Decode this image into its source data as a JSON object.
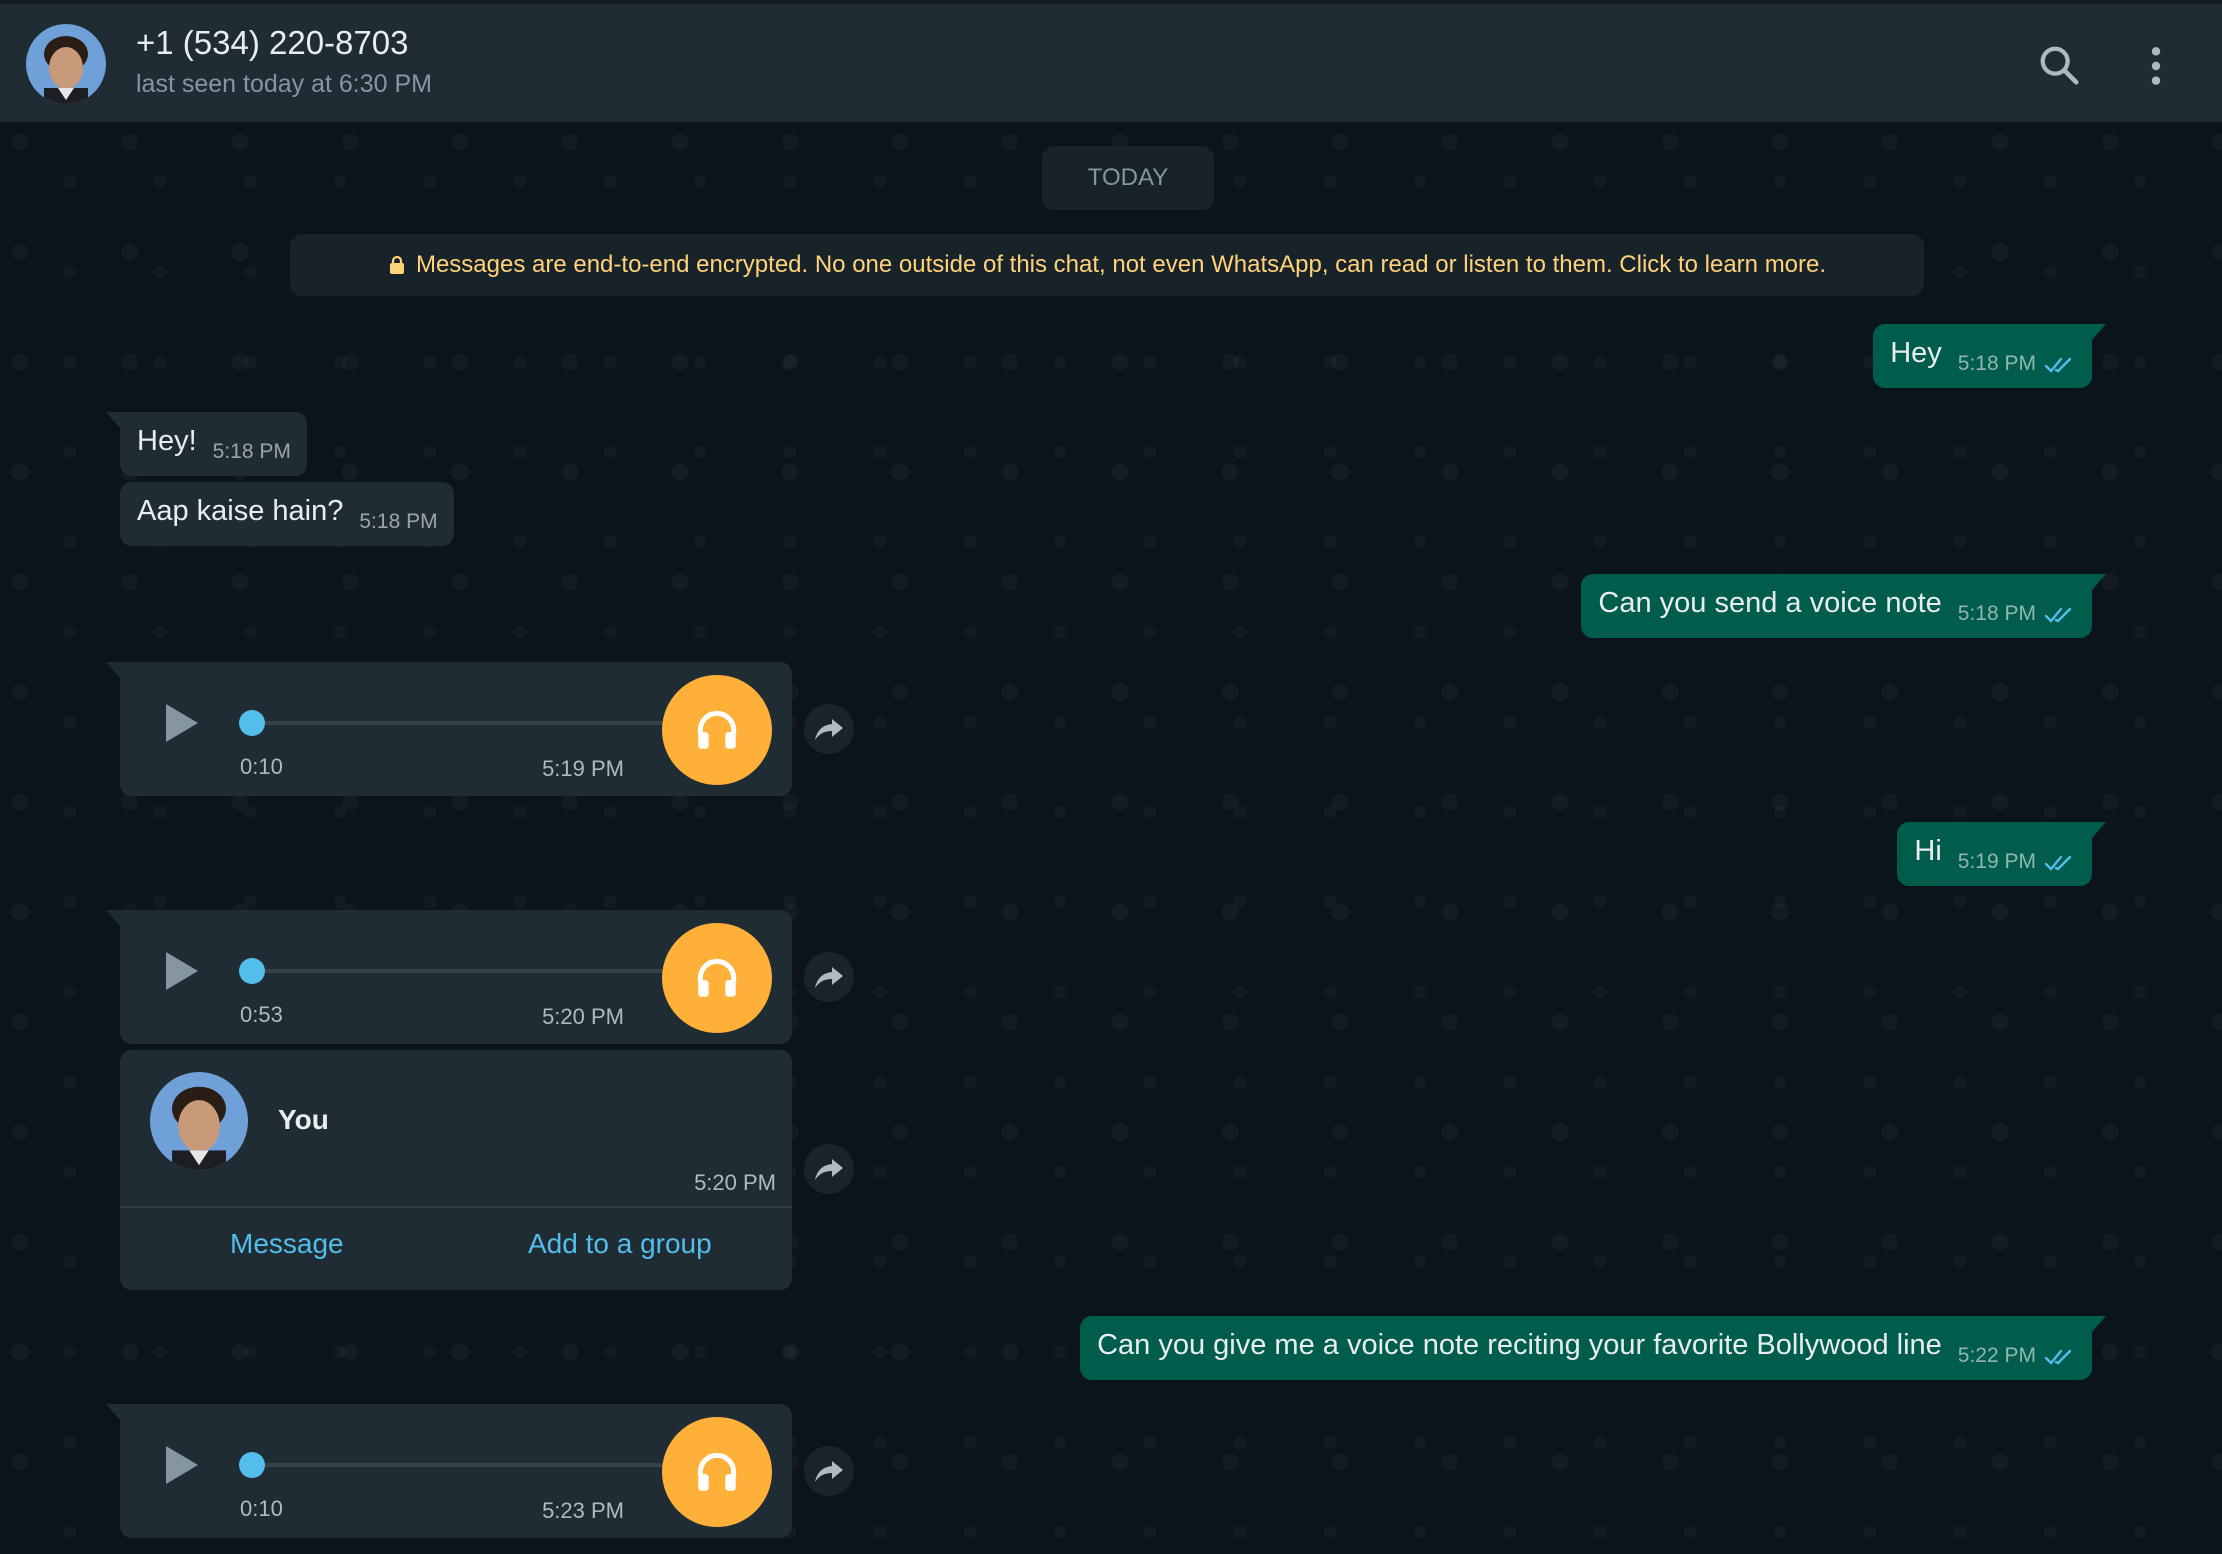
{
  "header": {
    "contact_name": "+1 (534) 220-8703",
    "status": "last seen today at 6:30 PM",
    "icons": [
      "avatar",
      "search-icon",
      "more-vertical-icon"
    ]
  },
  "chat": {
    "date_label": "TODAY",
    "encryption_notice": "Messages are end-to-end encrypted. No one outside of this chat, not even WhatsApp, can read or listen to them. Click to learn more.",
    "messages": [
      {
        "dir": "out",
        "text": "Hey",
        "time": "5:18 PM",
        "status": "read"
      },
      {
        "dir": "in",
        "text": "Hey!",
        "time": "5:18 PM"
      },
      {
        "dir": "in",
        "text": "Aap kaise hain?",
        "time": "5:18 PM"
      },
      {
        "dir": "out",
        "text": "Can you send a voice note",
        "time": "5:18 PM",
        "status": "read"
      },
      {
        "dir": "in",
        "type": "voice",
        "duration": "0:10",
        "time": "5:19 PM",
        "progress": 0
      },
      {
        "dir": "out",
        "text": "Hi",
        "time": "5:19 PM",
        "status": "read"
      },
      {
        "dir": "in",
        "type": "voice",
        "duration": "0:53",
        "time": "5:20 PM",
        "progress": 0
      },
      {
        "dir": "in",
        "type": "contact",
        "name": "You",
        "time": "5:20 PM",
        "actions": [
          "Message",
          "Add to a group"
        ]
      },
      {
        "dir": "out",
        "text": "Can you give me a voice note reciting your favorite Bollywood line",
        "time": "5:22 PM",
        "status": "read"
      },
      {
        "dir": "in",
        "type": "voice",
        "duration": "0:10",
        "time": "5:23 PM",
        "progress": 0
      }
    ]
  },
  "colors": {
    "header_bg": "#202c33",
    "chat_bg": "#0b141a",
    "outgoing_bubble": "#005c4b",
    "incoming_bubble": "#202c33",
    "tick_read": "#53bdeb",
    "voice_accent": "#ffb039",
    "link": "#53bdeb",
    "encryption_text": "#ffd279"
  }
}
